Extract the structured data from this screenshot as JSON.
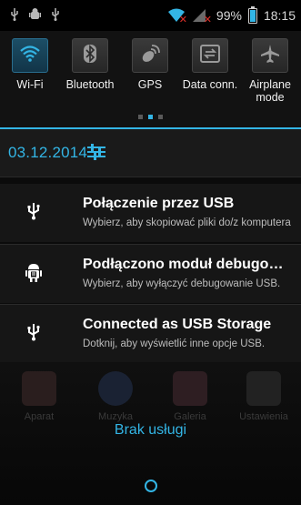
{
  "status_bar": {
    "battery_percent": "99%",
    "time": "18:15"
  },
  "quick_settings": {
    "toggles": [
      {
        "label": "Wi-Fi",
        "icon": "wifi-icon",
        "active": true
      },
      {
        "label": "Bluetooth",
        "icon": "bluetooth-icon",
        "active": false
      },
      {
        "label": "GPS",
        "icon": "gps-icon",
        "active": false
      },
      {
        "label": "Data conn.",
        "icon": "data-connection-icon",
        "active": false
      },
      {
        "label": "Airplane mode",
        "icon": "airplane-icon",
        "active": false
      }
    ],
    "page_indicator": {
      "pages": 3,
      "current": 2
    }
  },
  "date": "03.12.2014",
  "notifications": [
    {
      "icon": "usb-icon",
      "title": "Połączenie przez USB",
      "subtitle": "Wybierz, aby skopiować pliki do/z komputera"
    },
    {
      "icon": "android-debug-icon",
      "title": "Podłączono moduł debugowania USB",
      "subtitle": "Wybierz, aby wyłączyć debugowanie USB."
    },
    {
      "icon": "usb-icon",
      "title": "Connected as USB Storage",
      "subtitle": "Dotknij, aby wyświetlić inne opcje USB."
    }
  ],
  "home_apps": [
    {
      "label": "Aparat",
      "color": "#3a2a2a"
    },
    {
      "label": "Muzyka",
      "color": "#1f2a3a"
    },
    {
      "label": "Galeria",
      "color": "#3a2a1f"
    },
    {
      "label": "Ustawienia",
      "color": "#2a2a2a"
    }
  ],
  "carrier_text": "Brak usługi",
  "colors": {
    "accent": "#33b5e5",
    "error": "#e0302a"
  }
}
